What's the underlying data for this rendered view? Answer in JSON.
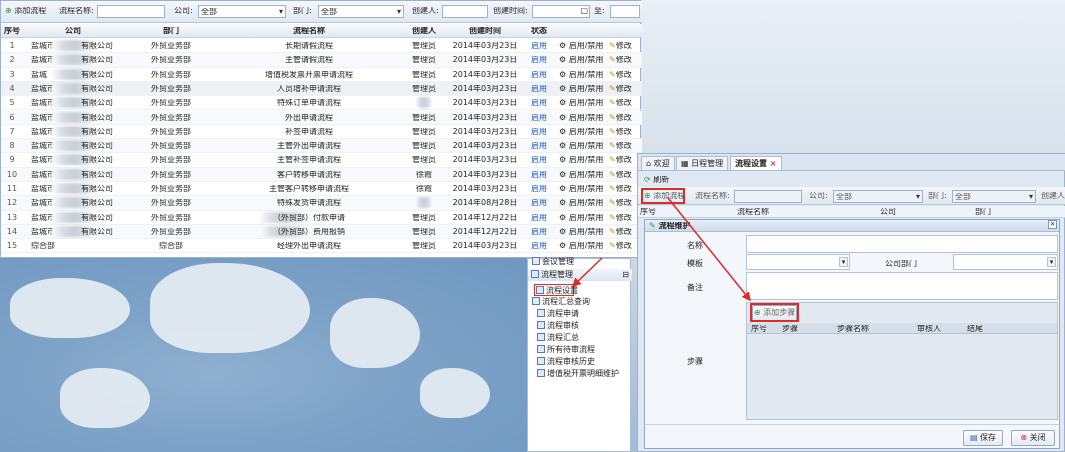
{
  "toolbar": {
    "add_label": "添加流程",
    "name_label": "流程名称:",
    "company_label": "公司:",
    "company_value": "全部",
    "dept_label": "部门:",
    "dept_value": "全部",
    "creator_label": "创建人:",
    "created_label": "创建时间:",
    "to_label": "至:"
  },
  "grid": {
    "headers": [
      "序号",
      "公司",
      "部门",
      "流程名称",
      "创建人",
      "创建时间",
      "状态"
    ],
    "toggle_label": "启用/禁用",
    "edit_label": "修改",
    "rows": [
      {
        "n": "1",
        "company": "盐城市",
        "company2": "有限公司",
        "dept": "外贸业务部",
        "name": "长期请假流程",
        "creator": "管理员",
        "date": "2014年03月23日",
        "status": "启用"
      },
      {
        "n": "2",
        "company": "盐城市",
        "company2": "有限公司",
        "dept": "外贸业务部",
        "name": "主管请假流程",
        "creator": "管理员",
        "date": "2014年03月23日",
        "status": "启用"
      },
      {
        "n": "3",
        "company": "盐城",
        "company2": "有限公司",
        "dept": "外贸业务部",
        "name": "增值税发票开票申请流程",
        "creator": "管理员",
        "date": "2014年03月23日",
        "status": "启用"
      },
      {
        "n": "4",
        "company": "盐城市",
        "company2": "有限公司",
        "dept": "外贸业务部",
        "name": "人员增补申请流程",
        "creator": "管理员",
        "date": "2014年03月23日",
        "status": "启用"
      },
      {
        "n": "5",
        "company": "盐城市",
        "company2": "有限公司",
        "dept": "外贸业务部",
        "name": "特殊订单申请流程",
        "creator": "",
        "date": "2014年03月23日",
        "status": "启用"
      },
      {
        "n": "6",
        "company": "盐城市",
        "company2": "有限公司",
        "dept": "外贸业务部",
        "name": "外出申请流程",
        "creator": "管理员",
        "date": "2014年03月23日",
        "status": "启用"
      },
      {
        "n": "7",
        "company": "盐城市",
        "company2": "有限公司",
        "dept": "外贸业务部",
        "name": "补签申请流程",
        "creator": "管理员",
        "date": "2014年03月23日",
        "status": "启用"
      },
      {
        "n": "8",
        "company": "盐城市",
        "company2": "有限公司",
        "dept": "外贸业务部",
        "name": "主管外出申请流程",
        "creator": "管理员",
        "date": "2014年03月23日",
        "status": "启用"
      },
      {
        "n": "9",
        "company": "盐城市",
        "company2": "有限公司",
        "dept": "外贸业务部",
        "name": "主管补签申请流程",
        "creator": "管理员",
        "date": "2014年03月23日",
        "status": "启用"
      },
      {
        "n": "10",
        "company": "盐城市",
        "company2": "有限公司",
        "dept": "外贸业务部",
        "name": "客户转移申请流程",
        "creator": "徐霞",
        "date": "2014年03月23日",
        "status": "启用"
      },
      {
        "n": "11",
        "company": "盐城市",
        "company2": "有限公司",
        "dept": "外贸业务部",
        "name": "主管客户转移申请流程",
        "creator": "徐霞",
        "date": "2014年03月23日",
        "status": "启用"
      },
      {
        "n": "12",
        "company": "盐城市",
        "company2": "有限公司",
        "dept": "外贸业务部",
        "name": "特殊发货申请流程",
        "creator": "",
        "date": "2014年08月28日",
        "status": "启用"
      },
      {
        "n": "13",
        "company": "盐城市",
        "company2": "有限公司",
        "dept": "外贸业务部",
        "name": "（外贸部）付款申请",
        "creator": "管理员",
        "date": "2014年12月22日",
        "status": "启用"
      },
      {
        "n": "14",
        "company": "盐城市",
        "company2": "有限公司",
        "dept": "外贸业务部",
        "name": "（外贸部）费用报销",
        "creator": "管理员",
        "date": "2014年12月22日",
        "status": "启用"
      },
      {
        "n": "15",
        "company": "综合部",
        "company2": "",
        "dept": "综合部",
        "name": "经理外出申请流程",
        "creator": "管理员",
        "date": "2014年03月23日",
        "status": "启用"
      }
    ]
  },
  "tree": {
    "partial_item": "会议管理",
    "group": "流程管理",
    "selected": "流程设置",
    "items": [
      "流程汇总查询",
      "流程申请",
      "流程审核",
      "流程汇总",
      "所有待审流程",
      "流程审核历史",
      "增值税开票明细维护"
    ]
  },
  "win2": {
    "tabs": [
      "欢迎",
      "日程管理",
      "流程设置"
    ],
    "refresh_label": "刷新",
    "add_label": "添加流程",
    "name_label": "流程名称:",
    "company_label": "公司:",
    "company_value": "全部",
    "dept_label": "部门:",
    "dept_value": "全部",
    "creator_label": "创建人",
    "grid_headers": [
      "序号",
      "流程名称",
      "公司",
      "部门"
    ]
  },
  "dialog": {
    "title": "流程维护",
    "name_label": "名称",
    "template_label": "模板",
    "company_dept_label": "公司部门",
    "note_label": "备注",
    "steps_label": "步骤",
    "add_step_label": "添加步骤",
    "step_headers": [
      "序号",
      "步骤",
      "步骤名称",
      "审核人",
      "结尾"
    ],
    "save_label": "保存",
    "close_label": "关闭"
  },
  "colors": {
    "accent": "#1455c4",
    "highlight": "#e02a2a"
  }
}
